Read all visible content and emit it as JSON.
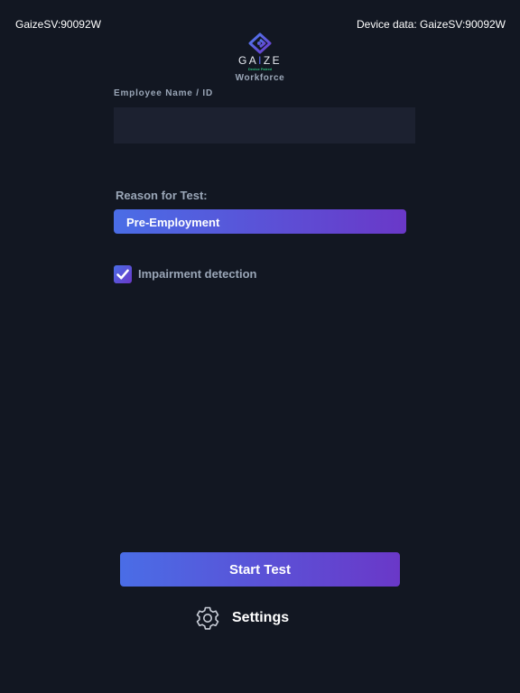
{
  "status_bar": {
    "device_id": "GaizeSV:90092W",
    "device_data": "Device data: GaizeSV:90092W"
  },
  "logo": {
    "icon": "gaize-eye-logo-icon",
    "word_prefix": "GA",
    "word_accent": "I",
    "word_suffix": "ZE",
    "tagline": "Device Paired",
    "subtitle": "Workforce"
  },
  "form": {
    "employee_label": "Employee Name / ID",
    "employee_value": "",
    "employee_placeholder": "",
    "reason_label": "Reason for Test:",
    "reason_value": "Pre-Employment",
    "impairment_label": "Impairment detection",
    "impairment_checked": true,
    "checkbox_icon": "checkmark-icon"
  },
  "actions": {
    "start_label": "Start Test",
    "settings_label": "Settings",
    "settings_icon": "gear-icon"
  },
  "colors": {
    "background": "#121722",
    "input_background": "#1c2130",
    "label": "#9aa6b7",
    "gradient_start": "#4a6de6",
    "gradient_end": "#6a38c8",
    "logo_accent": "#5a6cf5",
    "tagline": "#2ec27e"
  }
}
